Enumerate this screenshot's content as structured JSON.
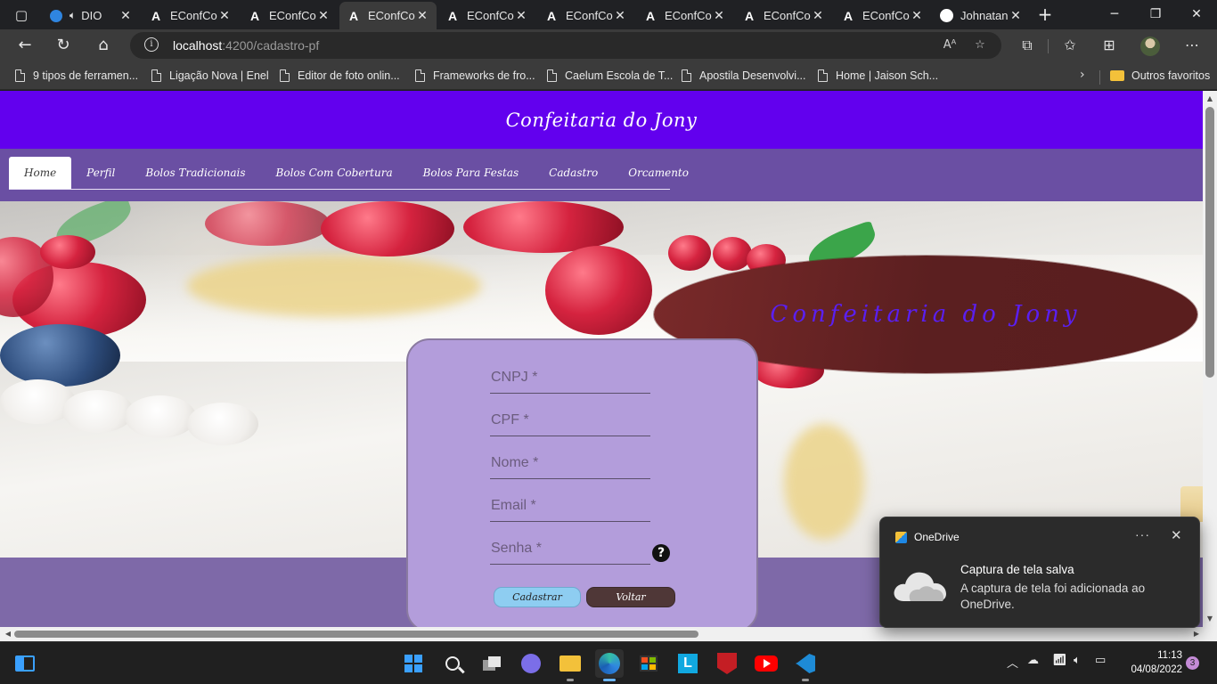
{
  "browser": {
    "tabs": [
      {
        "label": "DIO",
        "icon": "edge-icon",
        "audio": true,
        "active": false
      },
      {
        "label": "EConfCo",
        "icon": "angular-icon",
        "active": false
      },
      {
        "label": "EConfCo",
        "icon": "angular-icon",
        "active": false
      },
      {
        "label": "EConfCo",
        "icon": "angular-icon",
        "active": true
      },
      {
        "label": "EConfCo",
        "icon": "angular-icon",
        "active": false
      },
      {
        "label": "EConfCo",
        "icon": "angular-icon",
        "active": false
      },
      {
        "label": "EConfCo",
        "icon": "angular-icon",
        "active": false
      },
      {
        "label": "EConfCo",
        "icon": "angular-icon",
        "active": false
      },
      {
        "label": "EConfCo",
        "icon": "angular-icon",
        "active": false
      },
      {
        "label": "Johnatan",
        "icon": "github-icon",
        "active": false
      }
    ],
    "url": {
      "host": "localhost",
      "path": ":4200/cadastro-pf"
    },
    "bookmarks": [
      "9 tipos de ferramen...",
      "Ligação Nova | Enel",
      "Editor de foto onlin...",
      "Frameworks de fro...",
      "Caelum Escola de T...",
      "Apostila Desenvolvi...",
      "Home | Jaison Sch..."
    ],
    "other_favorites": "Outros favoritos"
  },
  "site": {
    "header_title": "Confeitaria do Jony",
    "nav": [
      "Home",
      "Perfil",
      "Bolos Tradicionais",
      "Bolos Com Cobertura",
      "Bolos Para Festas",
      "Cadastro",
      "Orcamento"
    ],
    "active_nav": "Home",
    "banner_text": "Confeitaria do Jony"
  },
  "form": {
    "fields": [
      {
        "placeholder": "CNPJ *"
      },
      {
        "placeholder": "CPF *"
      },
      {
        "placeholder": "Nome *"
      },
      {
        "placeholder": "Email *"
      },
      {
        "placeholder": "Senha *"
      }
    ],
    "help_symbol": "?",
    "submit_label": "Cadastrar",
    "back_label": "Voltar"
  },
  "toast": {
    "app": "OneDrive",
    "title": "Captura de tela salva",
    "body": "A captura de tela foi adicionada ao OneDrive."
  },
  "taskbar": {
    "time": "11:13",
    "date": "04/08/2022",
    "notifications": "3"
  },
  "colors": {
    "header": "#6200ee",
    "nav_band": "#6a4fa3",
    "form_card": "#b39ddb",
    "banner": "#5b1f20",
    "banner_text": "#5a1ff0",
    "submit_button": "#8ecdf1",
    "back_button": "#4f3737"
  }
}
